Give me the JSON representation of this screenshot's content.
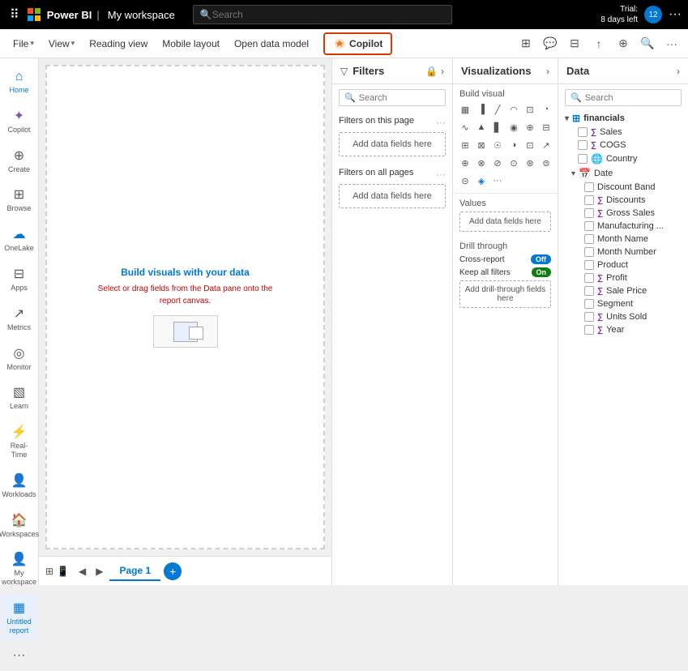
{
  "topbar": {
    "product": "Power BI",
    "workspace": "My workspace",
    "search_placeholder": "Search",
    "trial_label": "Trial:",
    "trial_days": "8 days left",
    "avatar_initials": "12"
  },
  "menubar": {
    "file_label": "File",
    "view_label": "View",
    "reading_view_label": "Reading view",
    "mobile_layout_label": "Mobile layout",
    "open_data_model_label": "Open data model",
    "copilot_label": "Copilot"
  },
  "sidebar": {
    "items": [
      {
        "id": "home",
        "label": "Home",
        "icon": "⌂"
      },
      {
        "id": "copilot",
        "label": "Copilot",
        "icon": "✦"
      },
      {
        "id": "create",
        "label": "Create",
        "icon": "+"
      },
      {
        "id": "browse",
        "label": "Browse",
        "icon": "⊞"
      },
      {
        "id": "onelake",
        "label": "OneLake",
        "icon": "☁"
      },
      {
        "id": "apps",
        "label": "Apps",
        "icon": "⊟"
      },
      {
        "id": "metrics",
        "label": "Metrics",
        "icon": "↗"
      },
      {
        "id": "monitor",
        "label": "Monitor",
        "icon": "◎"
      },
      {
        "id": "learn",
        "label": "Learn",
        "icon": "📖"
      },
      {
        "id": "realtime",
        "label": "Real-Time",
        "icon": "⚡"
      },
      {
        "id": "workloads",
        "label": "Workloads",
        "icon": "👤"
      },
      {
        "id": "workspaces",
        "label": "Workspaces",
        "icon": "🏠"
      }
    ],
    "bottom": {
      "my_workspace_label": "My workspace",
      "untitled_label": "Untitled report",
      "more_label": "..."
    }
  },
  "canvas": {
    "title": "Build visuals with your data",
    "subtitle": "Select or drag fields from the Data pane onto the\nreport canvas."
  },
  "filters": {
    "title": "Filters",
    "search_placeholder": "Search",
    "on_this_page_label": "Filters on this page",
    "on_all_pages_label": "Filters on all pages",
    "add_data_label": "Add data fields here"
  },
  "visualizations": {
    "title": "Visualizations",
    "expand_label": "›",
    "build_visual_label": "Build visual",
    "values_label": "Values",
    "add_fields_label": "Add data fields here",
    "drill_through_label": "Drill through",
    "cross_report_label": "Cross-report",
    "cross_report_value": "Off",
    "keep_filters_label": "Keep all filters",
    "keep_filters_value": "On",
    "add_drill_label": "Add drill-through fields here",
    "chart_icons": [
      "▦",
      "▐",
      "╱",
      "◠",
      "⊞",
      "⊡",
      "∿",
      "▲",
      "▋",
      "◉",
      "⊕",
      "⊟",
      "⊞",
      "⊠",
      "☉",
      "◑",
      "⊡",
      "↗",
      "⊕",
      "⊗",
      "⊘",
      "⊙",
      "⊛",
      "⊜",
      "⊝",
      "⊞",
      "⊟",
      "⊠",
      "⊡",
      "⊢",
      "+",
      "⊤",
      "⊥",
      "⊦",
      "⊧",
      "…"
    ]
  },
  "data_panel": {
    "title": "Data",
    "expand_label": "›",
    "search_placeholder": "Search",
    "groups": [
      {
        "id": "financials",
        "label": "financials",
        "expanded": true,
        "items": [
          {
            "label": "Sales",
            "type": "sum"
          },
          {
            "label": "COGS",
            "type": "sum"
          },
          {
            "label": "Country",
            "type": "field"
          }
        ],
        "subgroups": [
          {
            "label": "Date",
            "expanded": true,
            "items": [
              {
                "label": "Discount Band",
                "type": "field"
              },
              {
                "label": "Discounts",
                "type": "sum"
              },
              {
                "label": "Gross Sales",
                "type": "sum"
              },
              {
                "label": "Manufacturing ...",
                "type": "field"
              },
              {
                "label": "Month Name",
                "type": "field"
              },
              {
                "label": "Month Number",
                "type": "field"
              },
              {
                "label": "Product",
                "type": "field"
              },
              {
                "label": "Profit",
                "type": "sum"
              },
              {
                "label": "Sale Price",
                "type": "sum"
              },
              {
                "label": "Segment",
                "type": "field"
              },
              {
                "label": "Units Sold",
                "type": "sum"
              },
              {
                "label": "Year",
                "type": "sum"
              }
            ]
          }
        ]
      }
    ]
  },
  "page_bar": {
    "page_label": "Page 1",
    "add_page_label": "+"
  }
}
